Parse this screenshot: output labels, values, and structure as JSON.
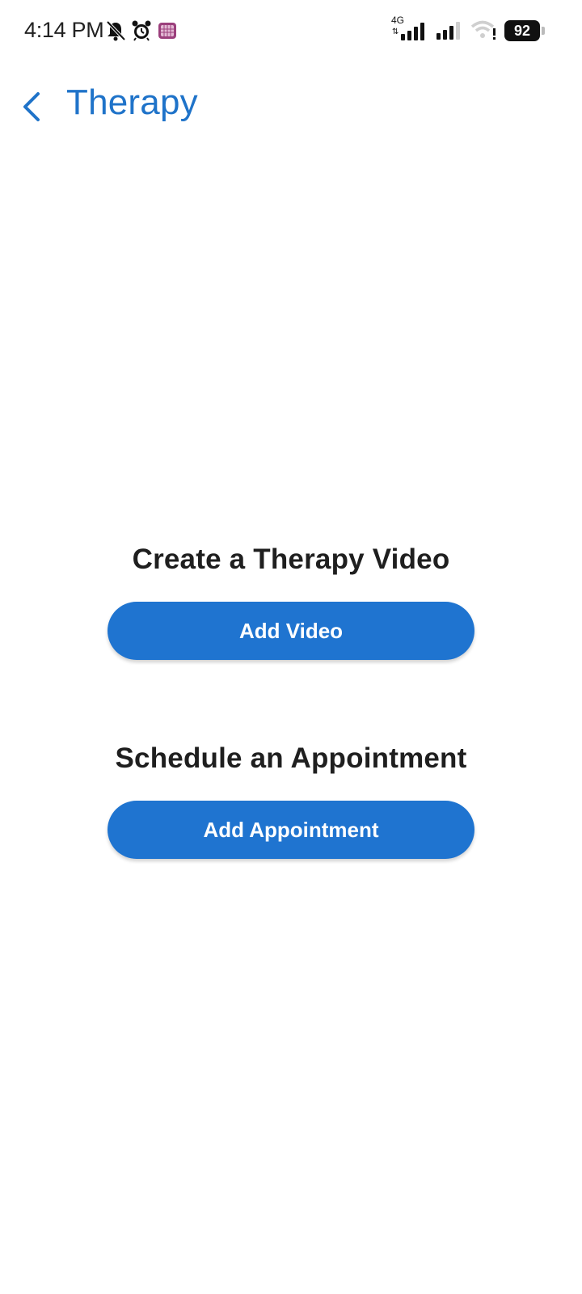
{
  "status_bar": {
    "time": "4:14 PM",
    "network_type": "4G",
    "battery_level": "92",
    "icons": [
      "mute-icon",
      "alarm-icon",
      "app-notification-icon",
      "signal-icon",
      "signal-icon",
      "wifi-warning-icon",
      "battery-icon"
    ]
  },
  "header": {
    "title": "Therapy",
    "back_icon": "chevron-left-icon"
  },
  "sections": {
    "video": {
      "title": "Create a Therapy Video",
      "button_label": "Add Video"
    },
    "appointment": {
      "title": "Schedule an Appointment",
      "button_label": "Add Appointment"
    }
  },
  "colors": {
    "accent": "#1f74d0",
    "title_color": "#1f73c9",
    "text": "#1f1f1f",
    "background": "#ffffff"
  }
}
